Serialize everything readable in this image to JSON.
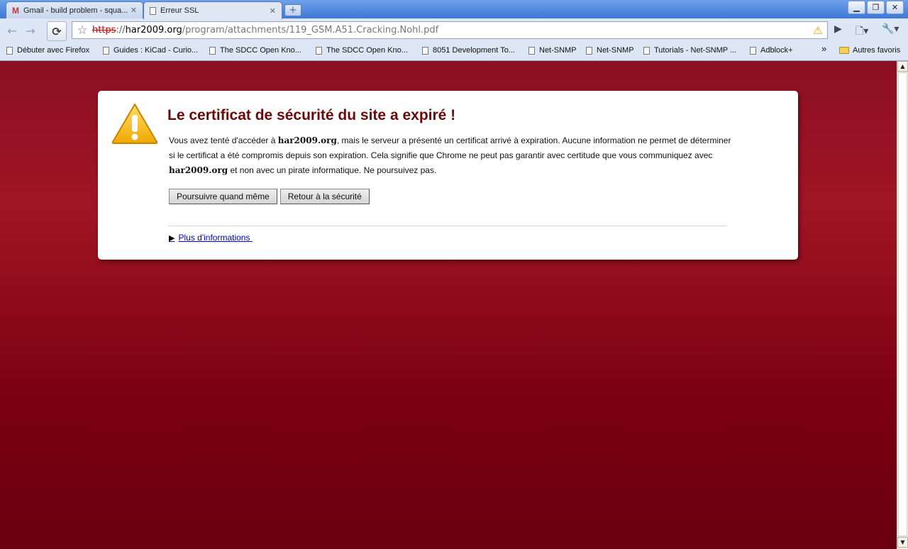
{
  "tabs": [
    {
      "title": "Gmail - build problem - squa...",
      "icon": "gmail-icon"
    },
    {
      "title": "Erreur SSL",
      "icon": "page-icon"
    }
  ],
  "toolbar": {
    "url_scheme": "https",
    "url_sep": "://",
    "url_host": "har2009.org",
    "url_path": "/program/attachments/119_GSM.A51.Cracking.Nohl.pdf"
  },
  "bookmarks": [
    {
      "label": "Débuter avec Firefox"
    },
    {
      "label": "Guides : KiCad - Curio..."
    },
    {
      "label": "The SDCC Open Kno..."
    },
    {
      "label": "The SDCC Open Kno..."
    },
    {
      "label": "8051 Development To..."
    },
    {
      "label": "Net-SNMP"
    },
    {
      "label": "Net-SNMP"
    },
    {
      "label": "Tutorials - Net-SNMP ..."
    },
    {
      "label": "Adblock+"
    }
  ],
  "other_bookmarks": "Autres favoris",
  "overflow": "»",
  "page": {
    "heading": "Le certificat de sécurité du site a expiré !",
    "p1_a": "Vous avez tenté d'accéder à ",
    "p1_host": "har2009.org",
    "p1_b": ", mais le serveur a présenté un certificat arrivé à expiration. Aucune information ne permet de déterminer si le certificat a été compromis depuis son expiration. Cela signifie que Chrome ne peut pas garantir avec certitude que vous communiquez avec ",
    "p1_host2": "har2009.org",
    "p1_c": " et non avec un pirate informatique. Ne poursuivez pas.",
    "proceed_label": "Poursuivre quand même",
    "back_label": "Retour à la sécurité",
    "more_label": "Plus d'informations"
  },
  "colors": {
    "background": "#8b0f22",
    "heading": "#6c0a0a",
    "link": "#0000c8"
  }
}
